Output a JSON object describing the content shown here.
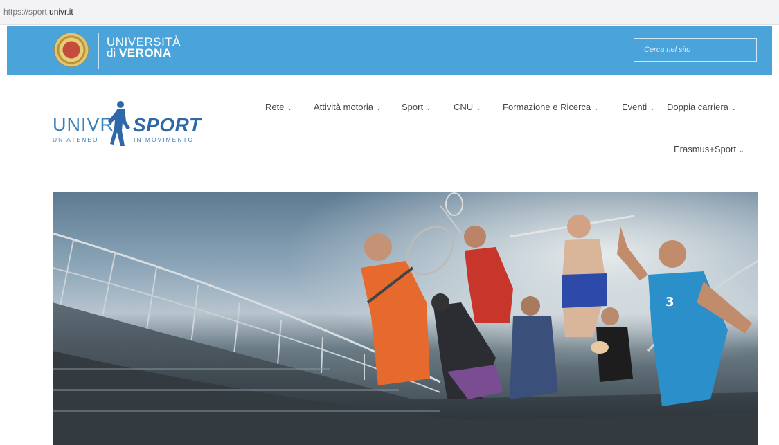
{
  "browser": {
    "url_prefix": "https://sport.",
    "url_domain": "univr.it"
  },
  "header": {
    "university_line1": "UNIVERSITÀ",
    "university_line2_prefix": "di ",
    "university_line2_bold": "VERONA",
    "search_placeholder": "Cerca nel sito"
  },
  "logo": {
    "univr": "UNIVR",
    "sport": "SPORT",
    "tagline_left": "UN ATENEO",
    "tagline_right": "IN MOVIMENTO"
  },
  "nav": {
    "items": [
      {
        "label": "Rete"
      },
      {
        "label": "Attività motoria"
      },
      {
        "label": "Sport"
      },
      {
        "label": "CNU"
      },
      {
        "label": "Formazione e Ricerca"
      },
      {
        "label": "Eventi"
      },
      {
        "label": "Doppia carriera"
      },
      {
        "label": "Erasmus+Sport"
      }
    ],
    "chevron": "⌄"
  },
  "hero": {
    "jersey_number": "3"
  },
  "colors": {
    "topbar": "#4aa3d9",
    "logo_blue": "#2e68a8"
  }
}
